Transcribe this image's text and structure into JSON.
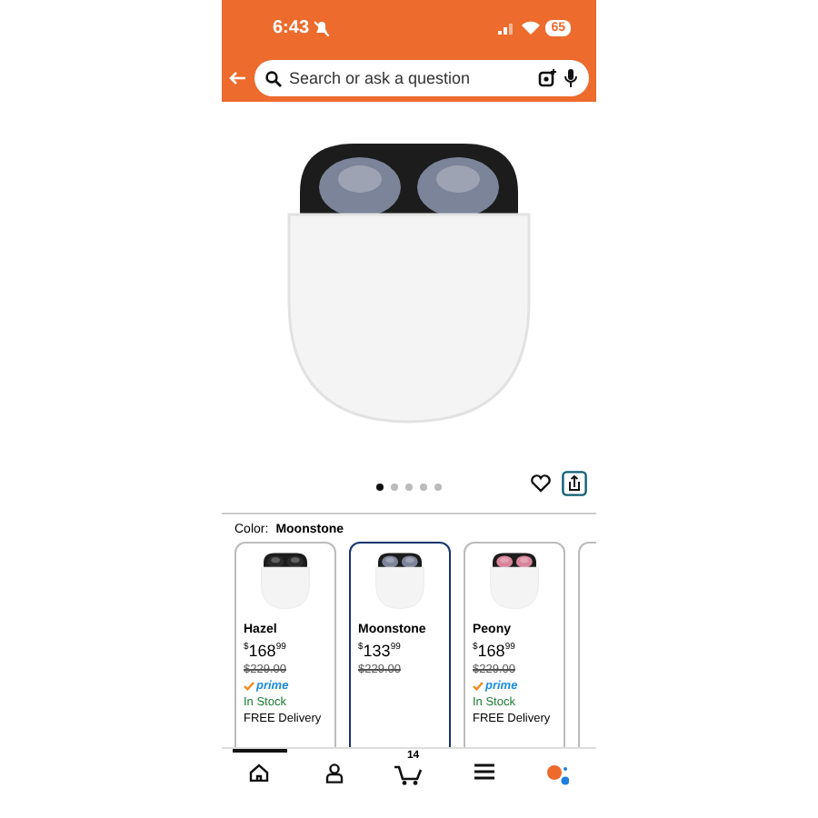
{
  "status_bar": {
    "time": "6:43",
    "battery": "65"
  },
  "search": {
    "placeholder": "Search or ask a question"
  },
  "gallery": {
    "dots": [
      {
        "selected": true
      },
      {
        "selected": false
      },
      {
        "selected": false
      },
      {
        "selected": false
      },
      {
        "selected": false
      }
    ]
  },
  "color": {
    "label": "Color:",
    "value": "Moonstone"
  },
  "variants": [
    {
      "name": "Hazel",
      "color": "#2b2b2b",
      "selected": false,
      "price": "$^{$}$168$^{99}$",
      "list_price": "$229.00",
      "prime": "prime",
      "stock": "In Stock",
      "delivery": "FREE Delivery"
    },
    {
      "name": "Moonstone",
      "color": "#7c8499",
      "selected": true,
      "price": "$^{$}$133$^{99}$",
      "list_price": "$229.00"
    },
    {
      "name": "Peony",
      "color": "#d9859c",
      "selected": false,
      "price": "$^{$}$168$^{99}$",
      "list_price": "$229.00",
      "prime": "prime",
      "stock": "In Stock",
      "delivery": "FREE Delivery"
    }
  ],
  "nav": {
    "cart_count": "14",
    "items": [
      {
        "kind": "home",
        "selected": true
      },
      {
        "kind": "account",
        "selected": false
      },
      {
        "kind": "cart",
        "selected": false
      },
      {
        "kind": "menu",
        "selected": false
      },
      {
        "kind": "assistant",
        "selected": false
      }
    ]
  }
}
